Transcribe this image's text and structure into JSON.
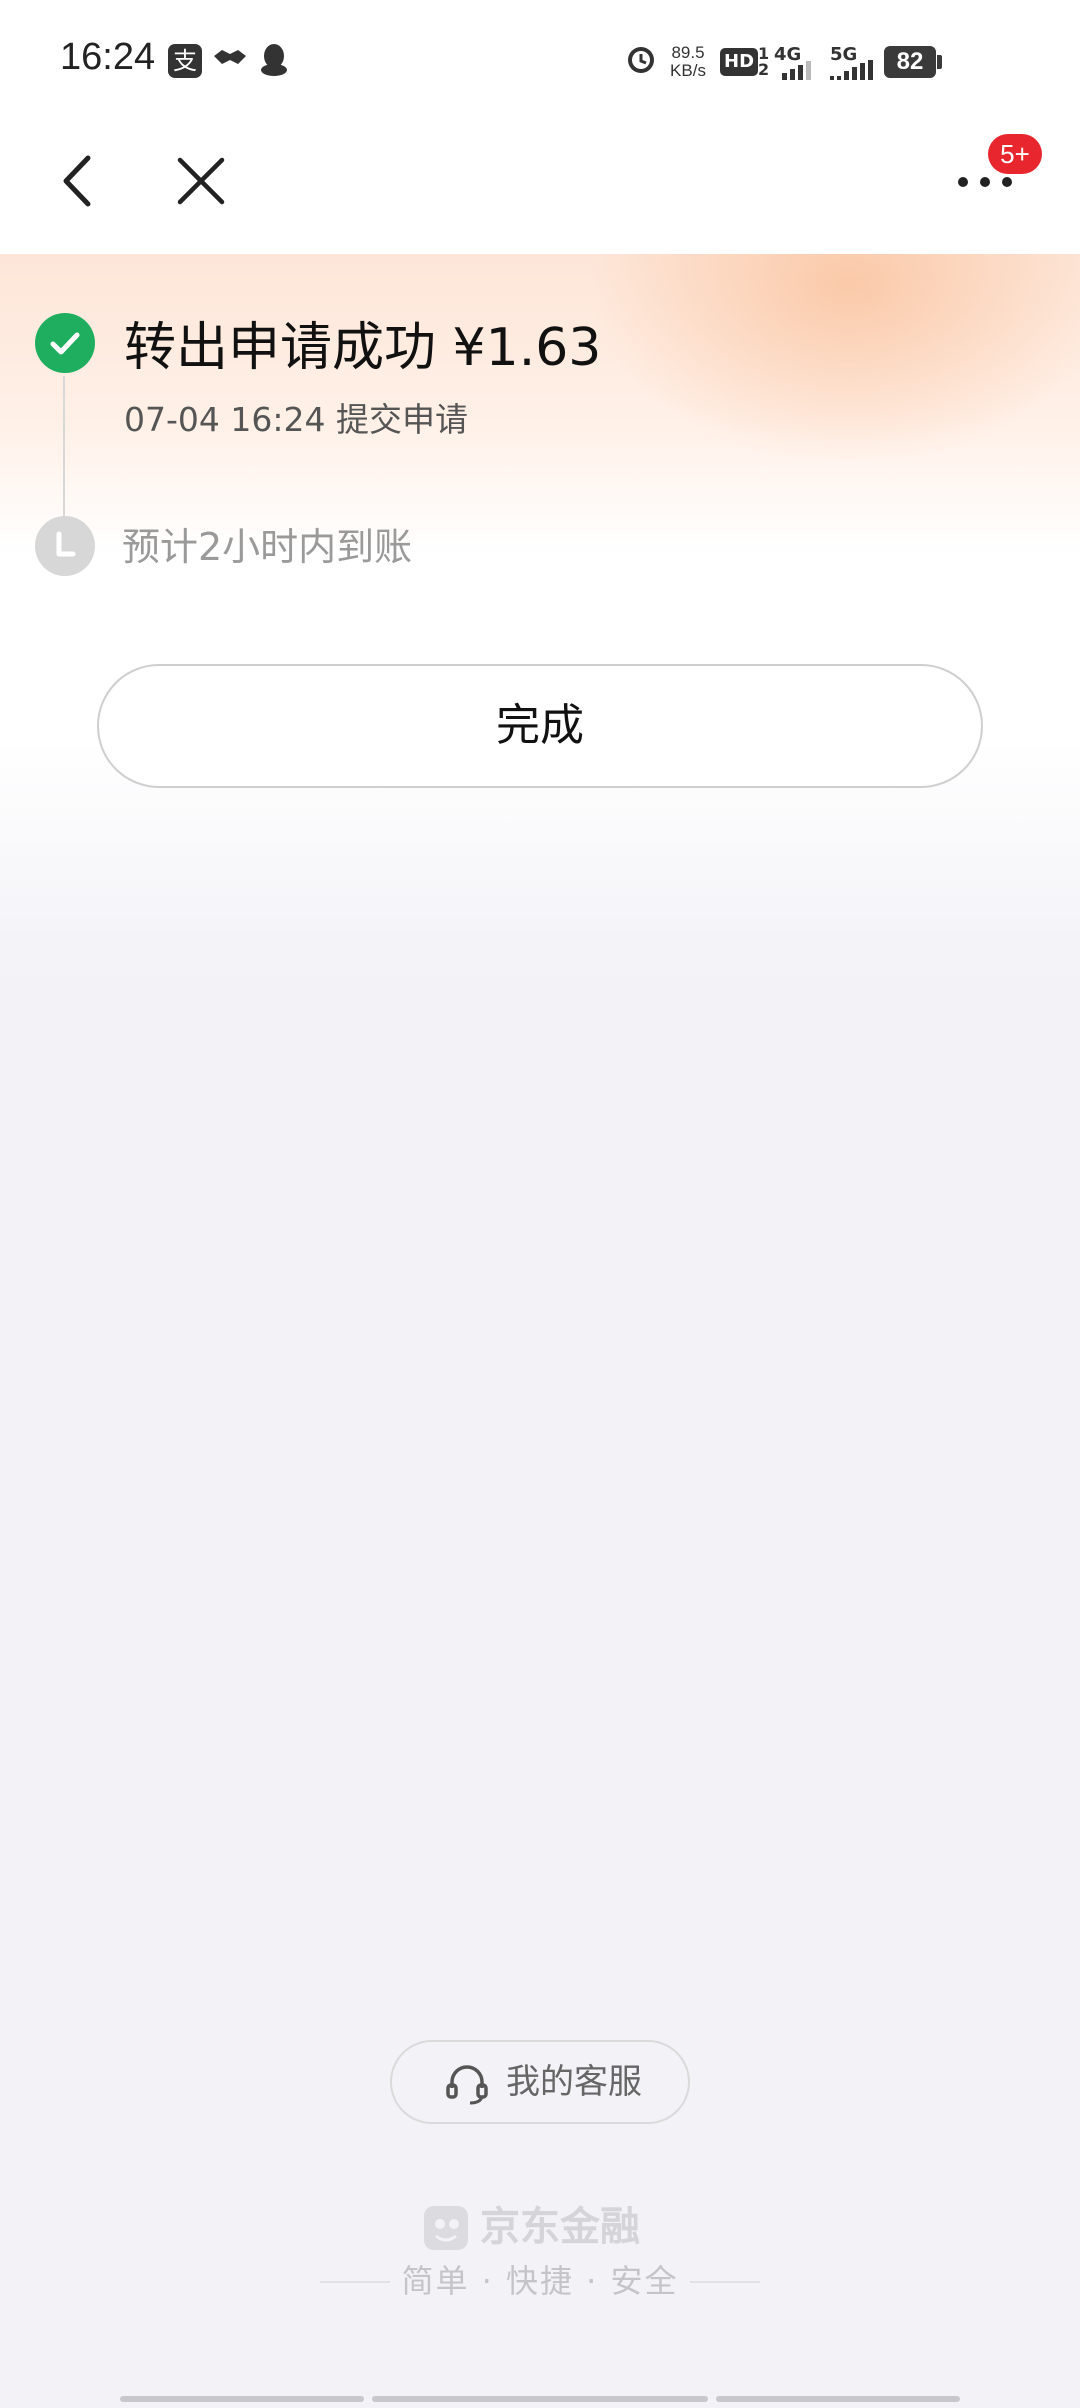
{
  "status_bar": {
    "time": "16:24",
    "notification_icons": [
      "alipay-icon",
      "handshake-icon",
      "qq-penguin-icon"
    ],
    "net_speed_value": "89.5",
    "net_speed_unit": "KB/s",
    "hd_label": "HD",
    "sim_labels": [
      "4G",
      "5G"
    ],
    "battery": "82"
  },
  "nav": {
    "back_icon": "chevron-left-icon",
    "close_icon": "close-icon",
    "more_icon": "more-dots-icon",
    "badge": "5+"
  },
  "timeline": {
    "step1_title": "转出申请成功 ¥1.63",
    "step1_time": "07-04 16:24 提交申请",
    "step2_text": "预计2小时内到账"
  },
  "actions": {
    "done_label": "完成"
  },
  "footer": {
    "service_label": "我的客服",
    "brand_name": "京东金融",
    "slogan": "简单 · 快捷 · 安全"
  },
  "colors": {
    "success": "#1fae5f",
    "pending": "#d7d7d7",
    "badge": "#e8262d",
    "page_bg": "#f2f2f7"
  }
}
